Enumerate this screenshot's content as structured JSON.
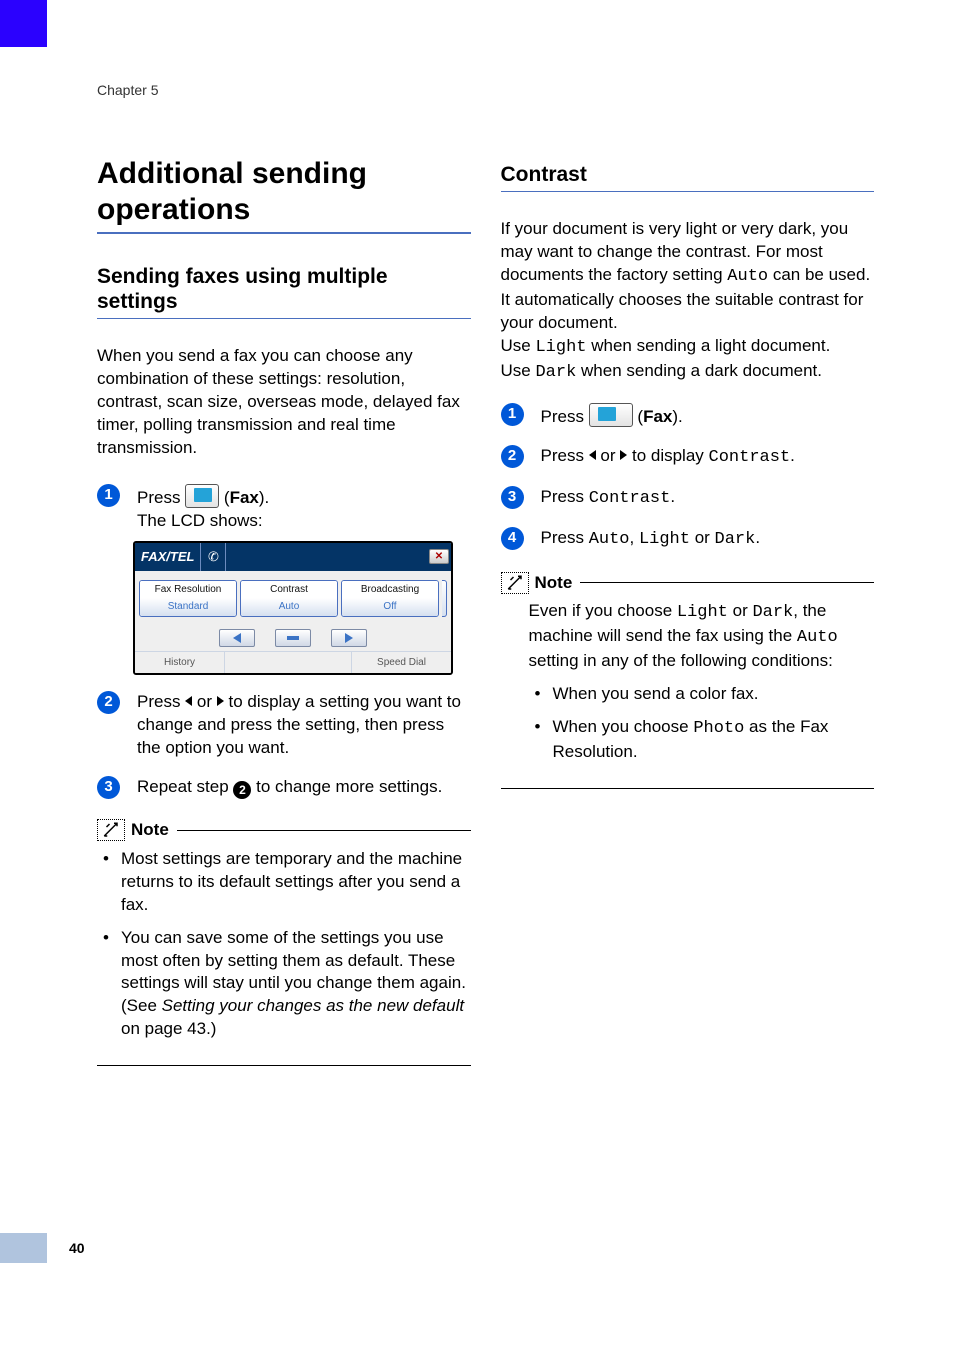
{
  "chapter": "Chapter 5",
  "page_number": "40",
  "left_column": {
    "h1": "Additional sending operations",
    "h2": "Sending faxes using multiple settings",
    "intro": "When you send a fax you can choose any combination of these settings: resolution, contrast, scan size, overseas mode, delayed fax timer, polling transmission and real time transmission.",
    "step1_press": "Press ",
    "step1_fax_open": "(",
    "step1_fax": "Fax",
    "step1_fax_close": ").",
    "step1_line2": "The LCD shows:",
    "step2_a": "Press ",
    "step2_b": " or ",
    "step2_c": " to display a setting you want to change and press the setting, then press the option you want.",
    "step3_a": "Repeat step ",
    "step3_ref": "2",
    "step3_b": " to change more settings.",
    "note_label": "Note",
    "note1_bullet1": "Most settings are temporary and the machine returns to its default settings after you send a fax.",
    "note1_bullet2_a": "You can save some of the settings you use most often by setting them as default. These settings will stay until you change them again. (See ",
    "note1_bullet2_italic": "Setting your changes as the new default",
    "note1_bullet2_b": " on page 43.)"
  },
  "lcd": {
    "fax_tel": "FAX/TEL",
    "s1_hdr": "Fax Resolution",
    "s1_val": "Standard",
    "s2_hdr": "Contrast",
    "s2_val": "Auto",
    "s3_hdr": "Broadcasting",
    "s3_val": "Off",
    "history": "History",
    "speed_dial": "Speed Dial"
  },
  "right_column": {
    "h2": "Contrast",
    "p1_a": "If your document is very light or very dark, you may want to change the contrast. For most documents the factory setting ",
    "p1_auto": "Auto",
    "p1_b": " can be used. It automatically chooses the suitable contrast for your document.",
    "p2_a": "Use ",
    "p2_light": "Light",
    "p2_b": " when sending a light document.",
    "p3_a": "Use ",
    "p3_dark": "Dark",
    "p3_b": " when sending a dark document.",
    "step1_press": "Press ",
    "step1_fax_open": "(",
    "step1_fax": "Fax",
    "step1_fax_close": ").",
    "step2_a": "Press ",
    "step2_b": " or ",
    "step2_c": " to display ",
    "step2_contrast": "Contrast",
    "step2_d": ".",
    "step3_a": "Press ",
    "step3_contrast": "Contrast",
    "step3_b": ".",
    "step4_a": "Press ",
    "step4_auto": "Auto",
    "step4_b": ", ",
    "step4_light": "Light",
    "step4_c": " or ",
    "step4_dark": "Dark",
    "step4_d": ".",
    "note_label": "Note",
    "note_text_a": "Even if you choose ",
    "note_text_b": " or ",
    "note_text_c": ", the machine will send the fax using the ",
    "note_text_d": " setting in any of the following conditions:",
    "note_bullet1": "When you send a color fax.",
    "note_bullet2_a": "When you choose ",
    "note_bullet2_photo": "Photo",
    "note_bullet2_b": " as the Fax Resolution."
  }
}
